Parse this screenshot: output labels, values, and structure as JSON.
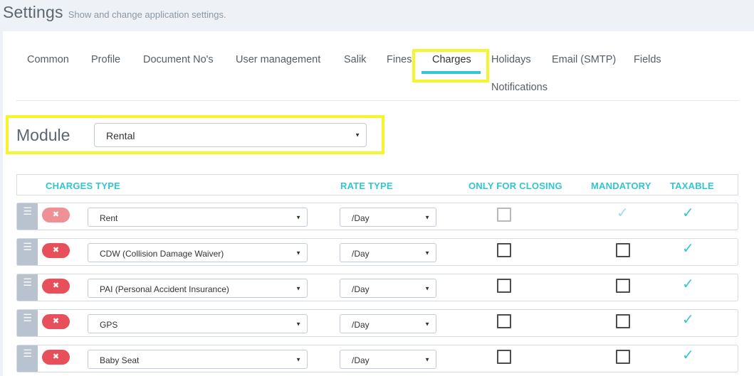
{
  "header": {
    "title": "Settings",
    "subtitle": "Show and change application settings."
  },
  "tabs": [
    {
      "label": "Common"
    },
    {
      "label": "Profile"
    },
    {
      "label": "Document No's"
    },
    {
      "label": "User management"
    },
    {
      "label": "Salik"
    },
    {
      "label": "Fines"
    },
    {
      "label": "Charges",
      "active": true
    },
    {
      "label": "Holidays"
    },
    {
      "label": "Email (SMTP)"
    },
    {
      "label": "Fields"
    },
    {
      "label": "Notifications"
    }
  ],
  "module": {
    "label": "Module",
    "selected": "Rental"
  },
  "table": {
    "columns": {
      "charges_type": "CHARGES TYPE",
      "rate_type": "RATE TYPE",
      "only_for_closing": "ONLY FOR CLOSING",
      "mandatory": "MANDATORY",
      "taxable": "TAXABLE"
    },
    "rows": [
      {
        "charge": "Rent",
        "rate": "/Day",
        "only_for_closing": false,
        "mandatory": true,
        "taxable": true,
        "locked": true
      },
      {
        "charge": "CDW (Collision Damage Waiver)",
        "rate": "/Day",
        "only_for_closing": false,
        "mandatory": false,
        "taxable": true,
        "locked": false
      },
      {
        "charge": "PAI (Personal Accident Insurance)",
        "rate": "/Day",
        "only_for_closing": false,
        "mandatory": false,
        "taxable": true,
        "locked": false
      },
      {
        "charge": "GPS",
        "rate": "/Day",
        "only_for_closing": false,
        "mandatory": false,
        "taxable": true,
        "locked": false
      },
      {
        "charge": "Baby Seat",
        "rate": "/Day",
        "only_for_closing": false,
        "mandatory": false,
        "taxable": true,
        "locked": false
      }
    ]
  },
  "icons": {
    "drag": "☰",
    "remove": "✖",
    "check": "✓",
    "caret": "▼"
  },
  "colors": {
    "accent": "#36c6d3",
    "highlight": "#f6f42a",
    "danger": "#e7505a",
    "handle": "#b8c3cf"
  }
}
